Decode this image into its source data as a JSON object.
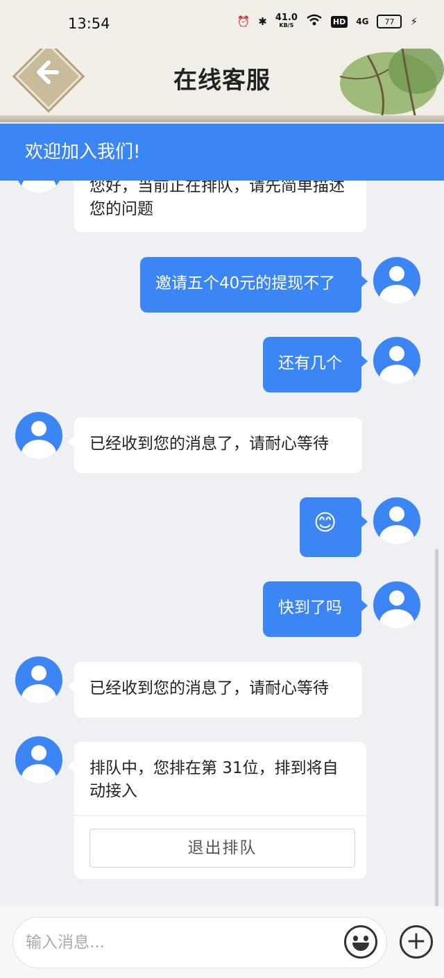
{
  "status_bar": {
    "time": "13:54",
    "net_speed": "41.0",
    "net_unit": "KB/S",
    "hd": "HD",
    "signal": "4G",
    "battery": "77"
  },
  "header": {
    "title": "在线客服",
    "back_icon": "back-arrow-icon"
  },
  "banner": {
    "text": "欢迎加入我们!"
  },
  "messages": [
    {
      "from": "agent",
      "text": "您好，当前正在排队，请先简单描述您的问题"
    },
    {
      "from": "user",
      "text": "邀请五个40元的提现不了"
    },
    {
      "from": "user",
      "text": "还有几个"
    },
    {
      "from": "agent",
      "text": "已经收到您的消息了，请耐心等待"
    },
    {
      "from": "user",
      "text": "😊"
    },
    {
      "from": "user",
      "text": "快到了吗"
    },
    {
      "from": "agent",
      "text": "已经收到您的消息了，请耐心等待"
    },
    {
      "from": "agent",
      "text": "排队中，您排在第 31位，排到将自动接入",
      "button": "退出排队"
    }
  ],
  "input": {
    "placeholder": "输入消息..."
  },
  "colors": {
    "accent": "#3b85f5",
    "background": "#eef0f3"
  }
}
